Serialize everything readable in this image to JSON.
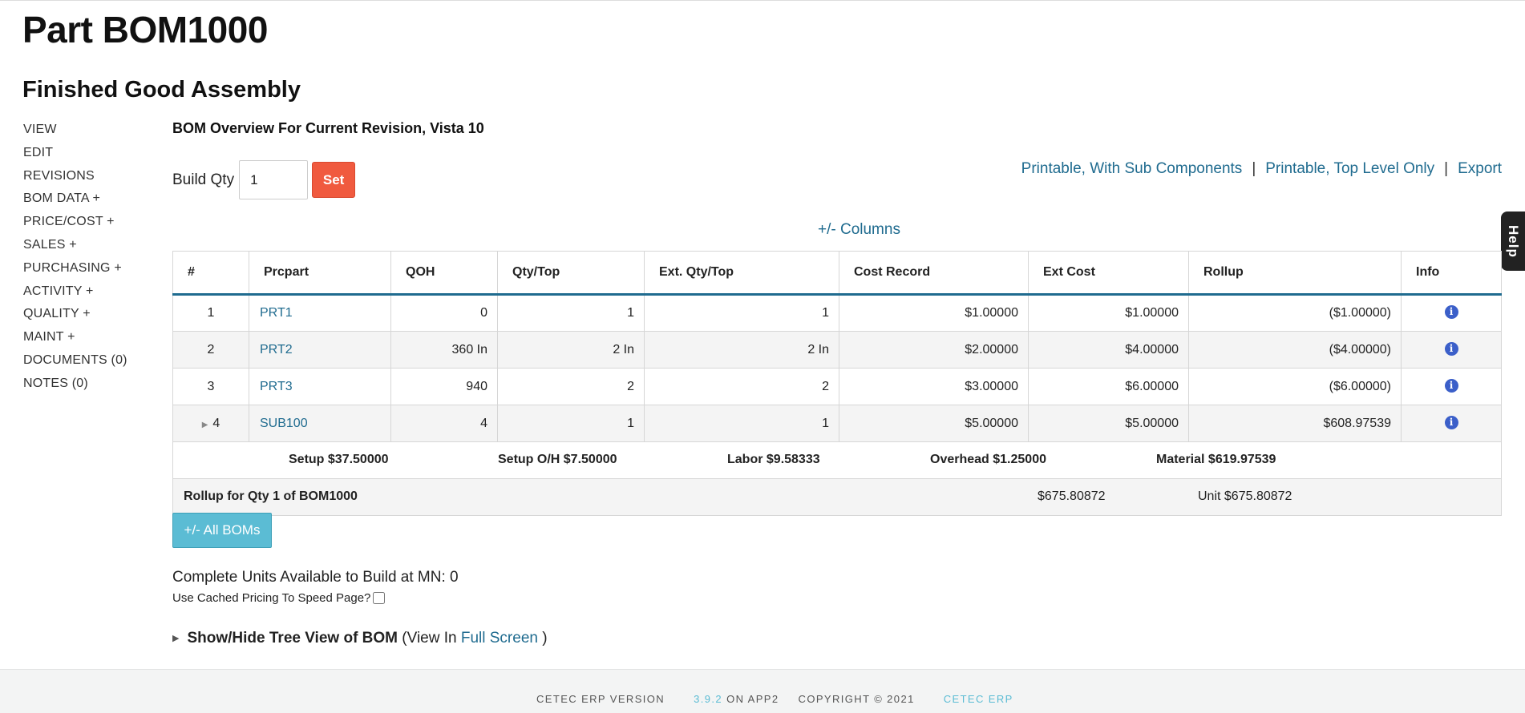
{
  "page": {
    "title": "Part BOM1000",
    "subtitle": "Finished Good Assembly"
  },
  "sidebar": {
    "items": [
      {
        "label": "VIEW"
      },
      {
        "label": "EDIT"
      },
      {
        "label": "REVISIONS"
      },
      {
        "label": "BOM DATA +"
      },
      {
        "label": "PRICE/COST +"
      },
      {
        "label": "SALES +"
      },
      {
        "label": "PURCHASING +"
      },
      {
        "label": "ACTIVITY +"
      },
      {
        "label": "QUALITY +"
      },
      {
        "label": "MAINT +"
      },
      {
        "label": "DOCUMENTS (0)"
      },
      {
        "label": "NOTES (0)"
      }
    ]
  },
  "overview": {
    "title": "BOM Overview For Current Revision, Vista 10"
  },
  "build": {
    "label": "Build Qty",
    "value": "1",
    "set_label": "Set"
  },
  "print_links": {
    "with_sub": "Printable, With Sub Components",
    "top_level": "Printable, Top Level Only",
    "export": "Export",
    "separator": "|"
  },
  "columns_toggle": "+/- Columns",
  "help": "Help",
  "table": {
    "headers": [
      "#",
      "Prcpart",
      "QOH",
      "Qty/Top",
      "Ext. Qty/Top",
      "Cost Record",
      "Ext Cost",
      "Rollup",
      "Info"
    ],
    "rows": [
      {
        "num": "1",
        "part": "PRT1",
        "qoh": "0",
        "qty_top": "1",
        "ext_qty_top": "1",
        "cost_record": "$1.00000",
        "ext_cost": "$1.00000",
        "rollup": "($1.00000)"
      },
      {
        "num": "2",
        "part": "PRT2",
        "qoh": "360 In",
        "qty_top": "2 In",
        "ext_qty_top": "2 In",
        "cost_record": "$2.00000",
        "ext_cost": "$4.00000",
        "rollup": "($4.00000)"
      },
      {
        "num": "3",
        "part": "PRT3",
        "qoh": "940",
        "qty_top": "2",
        "ext_qty_top": "2",
        "cost_record": "$3.00000",
        "ext_cost": "$6.00000",
        "rollup": "($6.00000)"
      },
      {
        "num": "4",
        "part": "SUB100",
        "qoh": "4",
        "qty_top": "1",
        "ext_qty_top": "1",
        "cost_record": "$5.00000",
        "ext_cost": "$5.00000",
        "rollup": "$608.97539"
      }
    ],
    "summary": {
      "setup": "Setup $37.50000",
      "setup_oh": "Setup O/H $7.50000",
      "labor": "Labor $9.58333",
      "overhead": "Overhead $1.25000",
      "material": "Material $619.97539"
    },
    "rollup": {
      "label": "Rollup for Qty 1 of BOM1000",
      "total": "$675.80872",
      "unit": "Unit $675.80872"
    }
  },
  "all_boms_label": "+/- All BOMs",
  "available": "Complete Units Available to Build at MN: 0",
  "cached_pricing": {
    "label": "Use Cached Pricing To Speed Page?",
    "checked": false
  },
  "tree_view": {
    "label": "Show/Hide Tree View of BOM",
    "view_in": "(View In",
    "full_screen": "Full Screen",
    "close": ")"
  },
  "footer": {
    "version_label": "CETEC ERP VERSION",
    "version": "3.9.2",
    "on_app": "ON APP2",
    "copyright": "COPYRIGHT © 2021",
    "brand": "CETEC ERP"
  }
}
